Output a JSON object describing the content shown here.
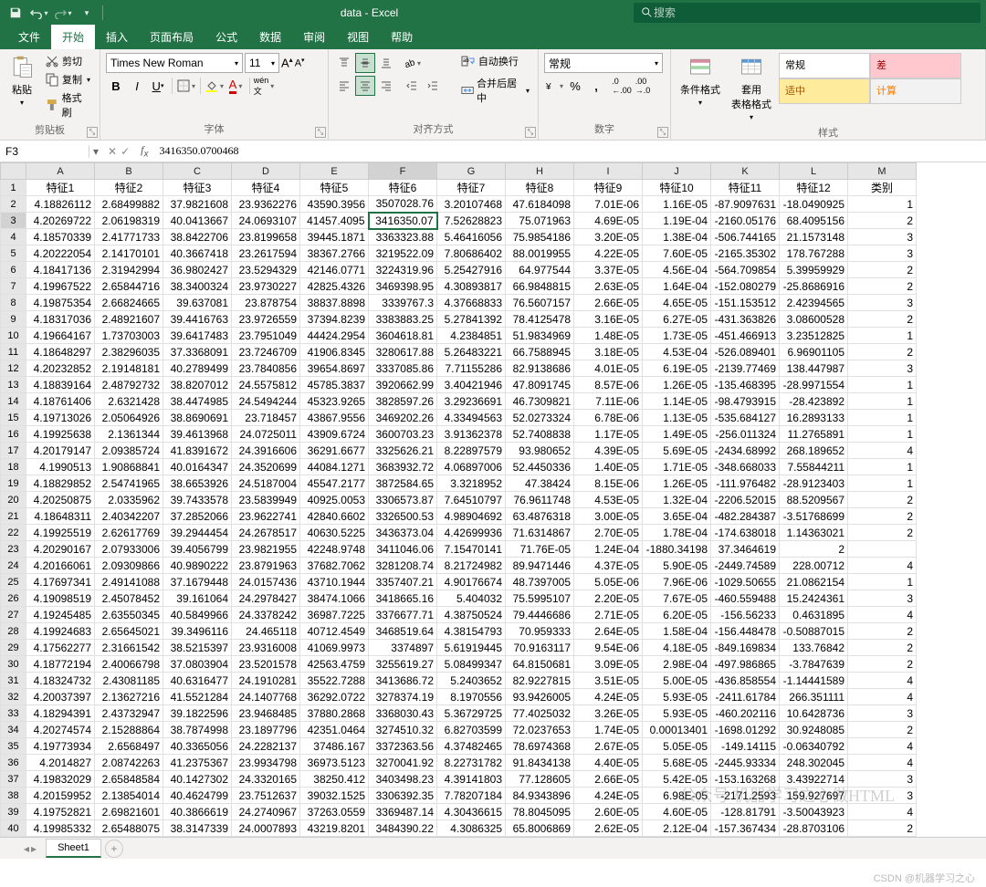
{
  "app": {
    "title": "data  -  Excel",
    "search_placeholder": "搜索"
  },
  "tabs": {
    "file": "文件",
    "home": "开始",
    "insert": "插入",
    "layout": "页面布局",
    "formulas": "公式",
    "data": "数据",
    "review": "审阅",
    "view": "视图",
    "help": "帮助"
  },
  "ribbon": {
    "clipboard": {
      "paste": "粘贴",
      "cut": "剪切",
      "copy": "复制",
      "format_painter": "格式刷",
      "label": "剪贴板"
    },
    "font": {
      "name": "Times New Roman",
      "size": "11",
      "label": "字体"
    },
    "align": {
      "wrap": "自动换行",
      "merge": "合并后居中",
      "label": "对齐方式"
    },
    "number": {
      "format": "常规",
      "label": "数字"
    },
    "styles": {
      "cond": "条件格式",
      "table": "套用\n表格格式",
      "normal": "常规",
      "bad": "差",
      "neutral": "适中",
      "calc": "计算",
      "label": "样式"
    }
  },
  "namebox": "F3",
  "formula": "3416350.0700468",
  "columns": [
    "A",
    "B",
    "C",
    "D",
    "E",
    "F",
    "G",
    "H",
    "I",
    "J",
    "K",
    "L",
    "M"
  ],
  "headers": [
    "特征1",
    "特征2",
    "特征3",
    "特征4",
    "特征5",
    "特征6",
    "特征7",
    "特征8",
    "特征9",
    "特征10",
    "特征11",
    "特征12",
    "类别"
  ],
  "rows": [
    [
      "4.18826112",
      "2.68499882",
      "37.9821608",
      "23.9362276",
      "43590.3956",
      "3507028.76",
      "3.20107468",
      "47.6184098",
      "7.01E-06",
      "1.16E-05",
      "-87.9097631",
      "-18.0490925",
      "1"
    ],
    [
      "4.20269722",
      "2.06198319",
      "40.0413667",
      "24.0693107",
      "41457.4095",
      "3416350.07",
      "7.52628823",
      "75.071963",
      "4.69E-05",
      "1.19E-04",
      "-2160.05176",
      "68.4095156",
      "2"
    ],
    [
      "4.18570339",
      "2.41771733",
      "38.8422706",
      "23.8199658",
      "39445.1871",
      "3363323.88",
      "5.46416056",
      "75.9854186",
      "3.20E-05",
      "1.38E-04",
      "-506.744165",
      "21.1573148",
      "3"
    ],
    [
      "4.20222054",
      "2.14170101",
      "40.3667418",
      "23.2617594",
      "38367.2766",
      "3219522.09",
      "7.80686402",
      "88.0019955",
      "4.22E-05",
      "7.60E-05",
      "-2165.35302",
      "178.767288",
      "3"
    ],
    [
      "4.18417136",
      "2.31942994",
      "36.9802427",
      "23.5294329",
      "42146.0771",
      "3224319.96",
      "5.25427916",
      "64.977544",
      "3.37E-05",
      "4.56E-04",
      "-564.709854",
      "5.39959929",
      "2"
    ],
    [
      "4.19967522",
      "2.65844716",
      "38.3400324",
      "23.9730227",
      "42825.4326",
      "3469398.95",
      "4.30893817",
      "66.9848815",
      "2.63E-05",
      "1.64E-04",
      "-152.080279",
      "-25.8686916",
      "2"
    ],
    [
      "4.19875354",
      "2.66824665",
      "39.637081",
      "23.878754",
      "38837.8898",
      "3339767.3",
      "4.37668833",
      "76.5607157",
      "2.66E-05",
      "4.65E-05",
      "-151.153512",
      "2.42394565",
      "3"
    ],
    [
      "4.18317036",
      "2.48921607",
      "39.4416763",
      "23.9726559",
      "37394.8239",
      "3383883.25",
      "5.27841392",
      "78.4125478",
      "3.16E-05",
      "6.27E-05",
      "-431.363826",
      "3.08600528",
      "2"
    ],
    [
      "4.19664167",
      "1.73703003",
      "39.6417483",
      "23.7951049",
      "44424.2954",
      "3604618.81",
      "4.2384851",
      "51.9834969",
      "1.48E-05",
      "1.73E-05",
      "-451.466913",
      "3.23512825",
      "1"
    ],
    [
      "4.18648297",
      "2.38296035",
      "37.3368091",
      "23.7246709",
      "41906.8345",
      "3280617.88",
      "5.26483221",
      "66.7588945",
      "3.18E-05",
      "4.53E-04",
      "-526.089401",
      "6.96901105",
      "2"
    ],
    [
      "4.20232852",
      "2.19148181",
      "40.2789499",
      "23.7840856",
      "39654.8697",
      "3337085.86",
      "7.71155286",
      "82.9138686",
      "4.01E-05",
      "6.19E-05",
      "-2139.77469",
      "138.447987",
      "3"
    ],
    [
      "4.18839164",
      "2.48792732",
      "38.8207012",
      "24.5575812",
      "45785.3837",
      "3920662.99",
      "3.40421946",
      "47.8091745",
      "8.57E-06",
      "1.26E-05",
      "-135.468395",
      "-28.9971554",
      "1"
    ],
    [
      "4.18761406",
      "2.6321428",
      "38.4474985",
      "24.5494244",
      "45323.9265",
      "3828597.26",
      "3.29236691",
      "46.7309821",
      "7.11E-06",
      "1.14E-05",
      "-98.4793915",
      "-28.423892",
      "1"
    ],
    [
      "4.19713026",
      "2.05064926",
      "38.8690691",
      "23.718457",
      "43867.9556",
      "3469202.26",
      "4.33494563",
      "52.0273324",
      "6.78E-06",
      "1.13E-05",
      "-535.684127",
      "16.2893133",
      "1"
    ],
    [
      "4.19925638",
      "2.1361344",
      "39.4613968",
      "24.0725011",
      "43909.6724",
      "3600703.23",
      "3.91362378",
      "52.7408838",
      "1.17E-05",
      "1.49E-05",
      "-256.011324",
      "11.2765891",
      "1"
    ],
    [
      "4.20179147",
      "2.09385724",
      "41.8391672",
      "24.3916606",
      "36291.6677",
      "3325626.21",
      "8.22897579",
      "93.980652",
      "4.39E-05",
      "5.69E-05",
      "-2434.68992",
      "268.189652",
      "4"
    ],
    [
      "4.1990513",
      "1.90868841",
      "40.0164347",
      "24.3520699",
      "44084.1271",
      "3683932.72",
      "4.06897006",
      "52.4450336",
      "1.40E-05",
      "1.71E-05",
      "-348.668033",
      "7.55844211",
      "1"
    ],
    [
      "4.18829852",
      "2.54741965",
      "38.6653926",
      "24.5187004",
      "45547.2177",
      "3872584.65",
      "3.3218952",
      "47.38424",
      "8.15E-06",
      "1.26E-05",
      "-111.976482",
      "-28.9123403",
      "1"
    ],
    [
      "4.20250875",
      "2.0335962",
      "39.7433578",
      "23.5839949",
      "40925.0053",
      "3306573.87",
      "7.64510797",
      "76.9611748",
      "4.53E-05",
      "1.32E-04",
      "-2206.52015",
      "88.5209567",
      "2"
    ],
    [
      "4.18648311",
      "2.40342207",
      "37.2852066",
      "23.9622741",
      "42840.6602",
      "3326500.53",
      "4.98904692",
      "63.4876318",
      "3.00E-05",
      "3.65E-04",
      "-482.284387",
      "-3.51768699",
      "2"
    ],
    [
      "4.19925519",
      "2.62617769",
      "39.2944454",
      "24.2678517",
      "40630.5225",
      "3436373.04",
      "4.42699936",
      "71.6314867",
      "2.70E-05",
      "1.78E-04",
      "-174.638018",
      "1.14363021",
      "2"
    ],
    [
      "4.20290167",
      "2.07933006",
      "39.4056799",
      "23.9821955",
      "42248.9748",
      "3411046.06",
      "7.15470141",
      "71.76E-05",
      "1.24E-04",
      "-1880.34198",
      "37.3464619",
      "2"
    ],
    [
      "4.20166061",
      "2.09309866",
      "40.9890222",
      "23.8791963",
      "37682.7062",
      "3281208.74",
      "8.21724982",
      "89.9471446",
      "4.37E-05",
      "5.90E-05",
      "-2449.74589",
      "228.00712",
      "4"
    ],
    [
      "4.17697341",
      "2.49141088",
      "37.1679448",
      "24.0157436",
      "43710.1944",
      "3357407.21",
      "4.90176674",
      "48.7397005",
      "5.05E-06",
      "7.96E-06",
      "-1029.50655",
      "21.0862154",
      "1"
    ],
    [
      "4.19098519",
      "2.45078452",
      "39.161064",
      "24.2978427",
      "38474.1066",
      "3418665.16",
      "5.404032",
      "75.5995107",
      "2.20E-05",
      "7.67E-05",
      "-460.559488",
      "15.2424361",
      "3"
    ],
    [
      "4.19245485",
      "2.63550345",
      "40.5849966",
      "24.3378242",
      "36987.7225",
      "3376677.71",
      "4.38750524",
      "79.4446686",
      "2.71E-05",
      "6.20E-05",
      "-156.56233",
      "0.4631895",
      "4"
    ],
    [
      "4.19924683",
      "2.65645021",
      "39.3496116",
      "24.465118",
      "40712.4549",
      "3468519.64",
      "4.38154793",
      "70.959333",
      "2.64E-05",
      "1.58E-04",
      "-156.448478",
      "-0.50887015",
      "2"
    ],
    [
      "4.17562277",
      "2.31661542",
      "38.5215397",
      "23.9316008",
      "41069.9973",
      "3374897",
      "5.61919445",
      "70.9163117",
      "9.54E-06",
      "4.18E-05",
      "-849.169834",
      "133.76842",
      "2"
    ],
    [
      "4.18772194",
      "2.40066798",
      "37.0803904",
      "23.5201578",
      "42563.4759",
      "3255619.27",
      "5.08499347",
      "64.8150681",
      "3.09E-05",
      "2.98E-04",
      "-497.986865",
      "-3.7847639",
      "2"
    ],
    [
      "4.18324732",
      "2.43081185",
      "40.6316477",
      "24.1910281",
      "35522.7288",
      "3413686.72",
      "5.2403652",
      "82.9227815",
      "3.51E-05",
      "5.00E-05",
      "-436.858554",
      "-1.14441589",
      "4"
    ],
    [
      "4.20037397",
      "2.13627216",
      "41.5521284",
      "24.1407768",
      "36292.0722",
      "3278374.19",
      "8.1970556",
      "93.9426005",
      "4.24E-05",
      "5.93E-05",
      "-2411.61784",
      "266.351111",
      "4"
    ],
    [
      "4.18294391",
      "2.43732947",
      "39.1822596",
      "23.9468485",
      "37880.2868",
      "3368030.43",
      "5.36729725",
      "77.4025032",
      "3.26E-05",
      "5.93E-05",
      "-460.202116",
      "10.6428736",
      "3"
    ],
    [
      "4.20274574",
      "2.15288864",
      "38.7874998",
      "23.1897796",
      "42351.0464",
      "3274510.32",
      "6.82703599",
      "72.0237653",
      "1.74E-05",
      "0.00013401",
      "-1698.01292",
      "30.9248085",
      "2"
    ],
    [
      "4.19773934",
      "2.6568497",
      "40.3365056",
      "24.2282137",
      "37486.167",
      "3372363.56",
      "4.37482465",
      "78.6974368",
      "2.67E-05",
      "5.05E-05",
      "-149.14115",
      "-0.06340792",
      "4"
    ],
    [
      "4.2014827",
      "2.08742263",
      "41.2375367",
      "23.9934798",
      "36973.5123",
      "3270041.92",
      "8.22731782",
      "91.8434138",
      "4.40E-05",
      "5.68E-05",
      "-2445.93334",
      "248.302045",
      "4"
    ],
    [
      "4.19832029",
      "2.65848584",
      "40.1427302",
      "24.3320165",
      "38250.412",
      "3403498.23",
      "4.39141803",
      "77.128605",
      "2.66E-05",
      "5.42E-05",
      "-153.163268",
      "3.43922714",
      "3"
    ],
    [
      "4.20159952",
      "2.13854014",
      "40.4624799",
      "23.7512637",
      "39032.1525",
      "3306392.35",
      "7.78207184",
      "84.9343896",
      "4.24E-05",
      "6.98E-05",
      "-2171.2593",
      "159.927697",
      "3"
    ],
    [
      "4.19752821",
      "2.69821601",
      "40.3866619",
      "24.2740967",
      "37263.0559",
      "3369487.14",
      "4.30436615",
      "78.8045095",
      "2.60E-05",
      "4.60E-05",
      "-128.81791",
      "-3.50043923",
      "4"
    ],
    [
      "4.19985332",
      "2.65488075",
      "38.3147339",
      "24.0007893",
      "43219.8201",
      "3484390.22",
      "4.3086325",
      "65.8006869",
      "2.62E-05",
      "2.12E-04",
      "-157.367434",
      "-28.8703106",
      "2"
    ]
  ],
  "active_cell": {
    "row": 2,
    "col": 5
  },
  "sheet": "Sheet1",
  "watermark": "公众号  机器学习之心做HTML",
  "watermark2": "CSDN @机器学习之心"
}
